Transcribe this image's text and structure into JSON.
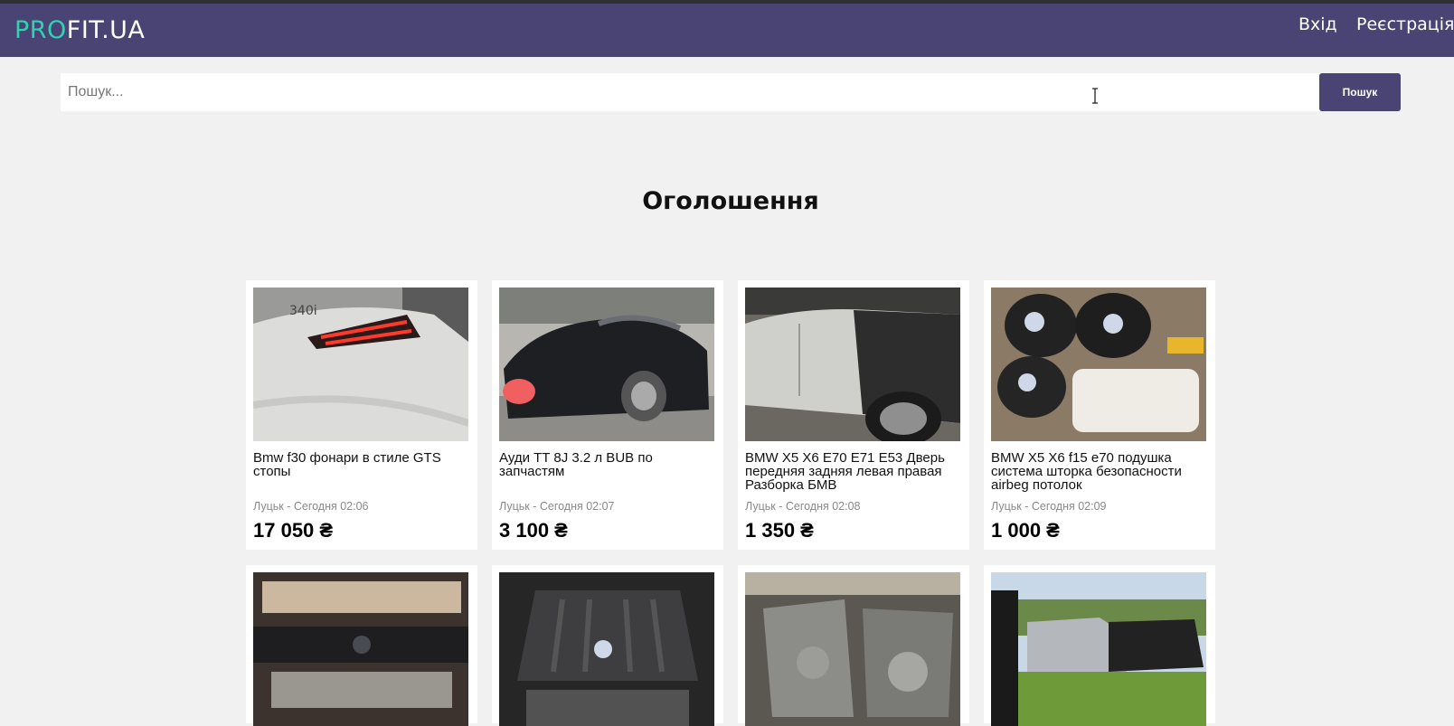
{
  "header": {
    "logo_pro": "PRO",
    "logo_rest": "FIT.UA",
    "login_label": "Вхід",
    "register_label": "Реєстрація",
    "brand_color": "#4a4474",
    "logo_accent": "#2ed3b3"
  },
  "search": {
    "placeholder": "Пошук...",
    "value": "",
    "button_label": "Пошук"
  },
  "main": {
    "heading": "Оголошення"
  },
  "listings": [
    {
      "title": "Bmw f30 фонари в стиле GTS стопы",
      "location": "Луцьк",
      "time": "Сегодня 02:06",
      "meta": "Луцьк - Сегодня 02:06",
      "price": "17 050 ₴",
      "image": "bmw-taillight-photo"
    },
    {
      "title": "Ауди TT 8J 3.2 л BUB по запчастям",
      "location": "Луцьк",
      "time": "Сегодня 02:07",
      "meta": "Луцьк - Сегодня 02:07",
      "price": "3 100 ₴",
      "image": "audi-tt-photo"
    },
    {
      "title": "BMW X5 X6 E70 E71 E53 Дверь передняя задняя левая правая Разборка БМВ",
      "location": "Луцьк",
      "time": "Сегодня 02:08",
      "meta": "Луцьк - Сегодня 02:08",
      "price": "1 350 ₴",
      "image": "bmw-x5-doors-photo"
    },
    {
      "title": "BMW X5 X6 f15 e70 подушка система шторка безопасности airbeg потолок",
      "location": "Луцьк",
      "time": "Сегодня 02:09",
      "meta": "Луцьк - Сегодня 02:09",
      "price": "1 000 ₴",
      "image": "airbags-photo"
    },
    {
      "image": "dashboards-photo"
    },
    {
      "image": "bmw-engine-photo"
    },
    {
      "image": "transfer-cases-photo"
    },
    {
      "image": "bmw-x5-yard-photo"
    }
  ]
}
